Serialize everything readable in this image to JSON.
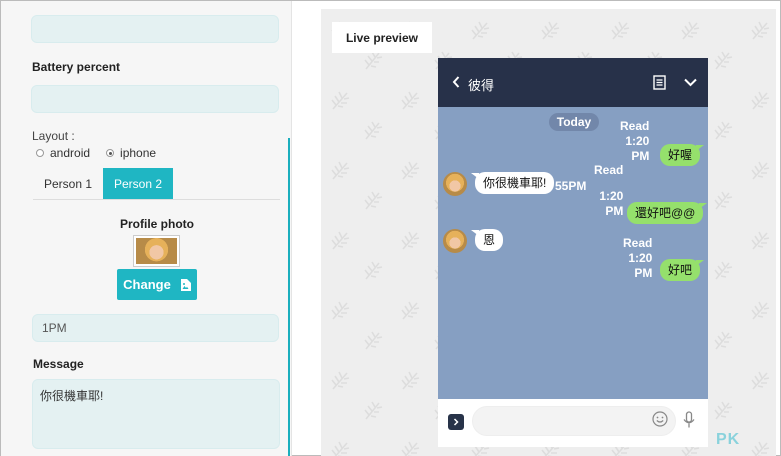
{
  "form": {
    "battery_label": "Battery percent",
    "layout_label": "Layout :",
    "layout_options": [
      {
        "label": "android",
        "checked": false
      },
      {
        "label": "iphone",
        "checked": true
      }
    ],
    "tabs": [
      {
        "label": "Person 1",
        "active": false
      },
      {
        "label": "Person 2",
        "active": true
      }
    ],
    "profile_photo_label": "Profile photo",
    "change_button": "Change",
    "time_value": "1PM",
    "message_label": "Message",
    "message_value": "你很機車耶!"
  },
  "preview": {
    "tab_label": "Live preview",
    "chat": {
      "contact_name": "彼得",
      "date_label": "Today",
      "messages": [
        {
          "side": "out",
          "status": "Read",
          "time1": "1:20",
          "time2": "PM",
          "text": "好喔"
        },
        {
          "side": "in",
          "text": "你很機車耶!",
          "time": "55PM"
        },
        {
          "side": "out",
          "status": "Read",
          "time1": "1:20",
          "time2": "PM",
          "text": "還好吧@@"
        },
        {
          "side": "in",
          "text": "恩"
        },
        {
          "side": "out",
          "status": "Read",
          "time1": "1:20",
          "time2": "PM",
          "text": "好吧"
        }
      ]
    }
  },
  "watermark": "PK",
  "colors": {
    "accent": "#1fb6c3",
    "chat_header": "#273149",
    "chat_bg": "#869fc2",
    "bubble_out": "#95e06c",
    "bubble_in": "#ffffff"
  }
}
